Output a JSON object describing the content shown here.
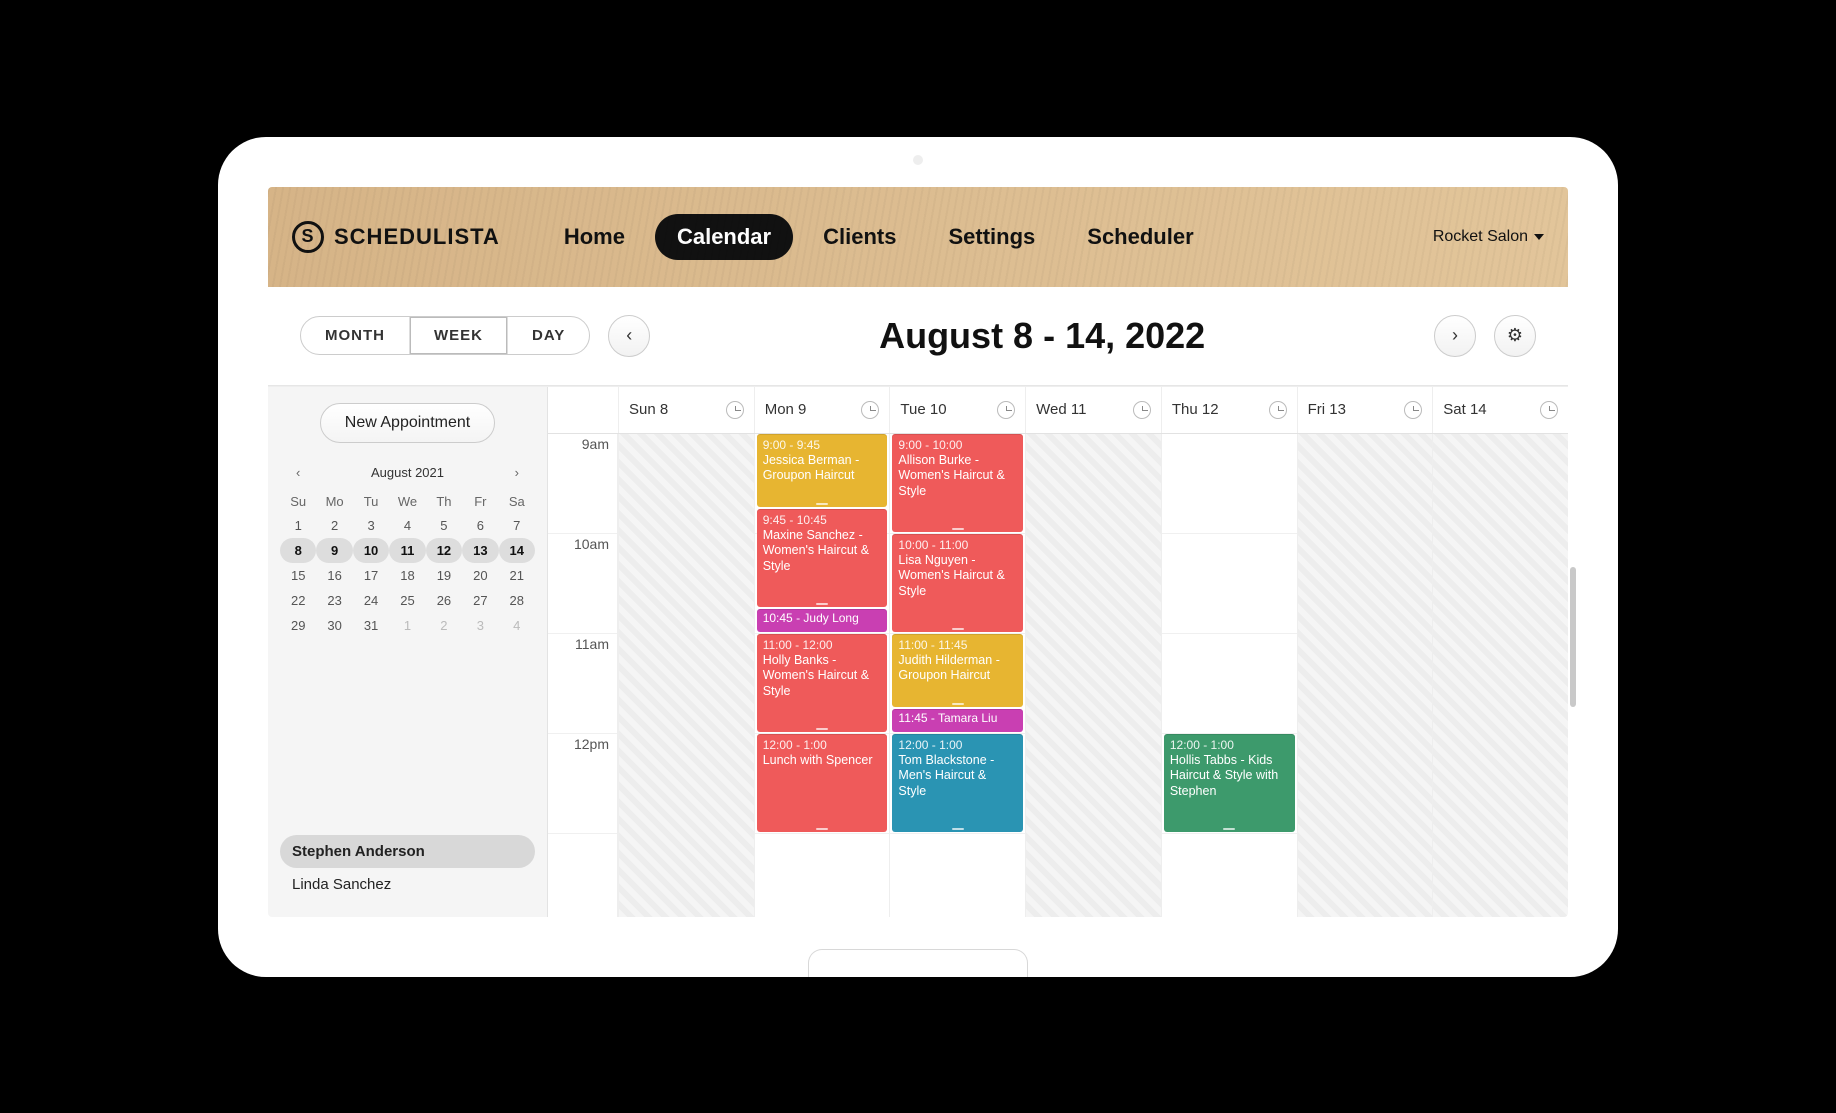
{
  "brand": "SCHEDULISTA",
  "nav": {
    "home": "Home",
    "calendar": "Calendar",
    "clients": "Clients",
    "settings": "Settings",
    "scheduler": "Scheduler"
  },
  "account": "Rocket Salon",
  "toolbar": {
    "views": {
      "month": "MONTH",
      "week": "WEEK",
      "day": "DAY"
    },
    "title": "August 8 - 14, 2022"
  },
  "sidebar": {
    "newAppt": "New Appointment",
    "miniTitle": "August 2021",
    "weekdays": [
      "Su",
      "Mo",
      "Tu",
      "We",
      "Th",
      "Fr",
      "Sa"
    ],
    "weeks": [
      [
        "1",
        "2",
        "3",
        "4",
        "5",
        "6",
        "7"
      ],
      [
        "8",
        "9",
        "10",
        "11",
        "12",
        "13",
        "14"
      ],
      [
        "15",
        "16",
        "17",
        "18",
        "19",
        "20",
        "21"
      ],
      [
        "22",
        "23",
        "24",
        "25",
        "26",
        "27",
        "28"
      ],
      [
        "29",
        "30",
        "31",
        "1",
        "2",
        "3",
        "4"
      ]
    ],
    "selectedWeekIndex": 1,
    "trailingOffStart": {
      "week": 4,
      "col": 3
    },
    "staff": [
      "Stephen Anderson",
      "Linda Sanchez"
    ],
    "staffActive": 0
  },
  "days": [
    "Sun 8",
    "Mon 9",
    "Tue 10",
    "Wed 11",
    "Thu 12",
    "Fri 13",
    "Sat 14"
  ],
  "closedDays": [
    0,
    3,
    5,
    6
  ],
  "hours": [
    "9am",
    "10am",
    "11am",
    "12pm"
  ],
  "hourStart": 9,
  "pxPerHour": 100,
  "events": [
    {
      "day": 1,
      "start": 9.0,
      "end": 9.75,
      "cls": "haircut-yellow",
      "time": "9:00 - 9:45",
      "text": "Jessica Berman - Groupon Haircut"
    },
    {
      "day": 1,
      "start": 9.75,
      "end": 10.75,
      "cls": "haircut-red",
      "time": "9:45 - 10:45",
      "text": "Maxine Sanchez - Women's Haircut & Style"
    },
    {
      "day": 1,
      "start": 10.75,
      "end": 11.0,
      "cls": "haircut-pink",
      "time": "10:45",
      "text": "Judy Long",
      "compact": true
    },
    {
      "day": 1,
      "start": 11.0,
      "end": 12.0,
      "cls": "haircut-red",
      "time": "11:00 - 12:00",
      "text": "Holly Banks - Women's Haircut & Style"
    },
    {
      "day": 1,
      "start": 12.0,
      "end": 13.0,
      "cls": "haircut-red",
      "time": "12:00 - 1:00",
      "text": "Lunch with Spencer"
    },
    {
      "day": 2,
      "start": 9.0,
      "end": 10.0,
      "cls": "haircut-red",
      "time": "9:00 - 10:00",
      "text": "Allison Burke - Women's Haircut & Style"
    },
    {
      "day": 2,
      "start": 10.0,
      "end": 11.0,
      "cls": "haircut-red",
      "time": "10:00 - 11:00",
      "text": "Lisa Nguyen - Women's Haircut & Style"
    },
    {
      "day": 2,
      "start": 11.0,
      "end": 11.75,
      "cls": "haircut-yellow",
      "time": "11:00 - 11:45",
      "text": "Judith Hilderman - Groupon Haircut"
    },
    {
      "day": 2,
      "start": 11.75,
      "end": 12.0,
      "cls": "haircut-pink",
      "time": "11:45",
      "text": "Tamara Liu",
      "compact": true
    },
    {
      "day": 2,
      "start": 12.0,
      "end": 13.0,
      "cls": "haircut-teal",
      "time": "12:00 - 1:00",
      "text": "Tom Blackstone - Men's Haircut & Style"
    },
    {
      "day": 4,
      "start": 12.0,
      "end": 13.0,
      "cls": "haircut-green",
      "time": "12:00 - 1:00",
      "text": "Hollis Tabbs - Kids Haircut & Style with Stephen"
    }
  ]
}
